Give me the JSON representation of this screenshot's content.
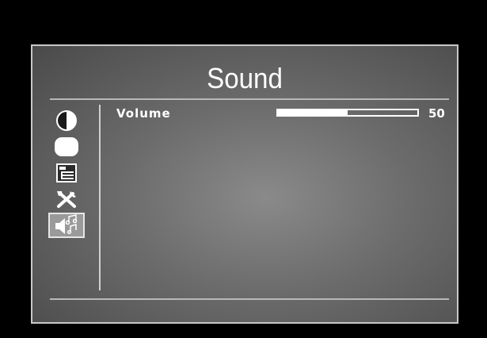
{
  "menu": {
    "title": "Sound",
    "items": [
      {
        "icon": "contrast-icon",
        "selected": false
      },
      {
        "icon": "display-icon",
        "selected": false
      },
      {
        "icon": "settings-panel-icon",
        "selected": false
      },
      {
        "icon": "tools-icon",
        "selected": false
      },
      {
        "icon": "speaker-music-icon",
        "selected": true
      }
    ]
  },
  "sound": {
    "volume_label": "Volume",
    "volume_value": "50",
    "volume_level": 0.5
  }
}
